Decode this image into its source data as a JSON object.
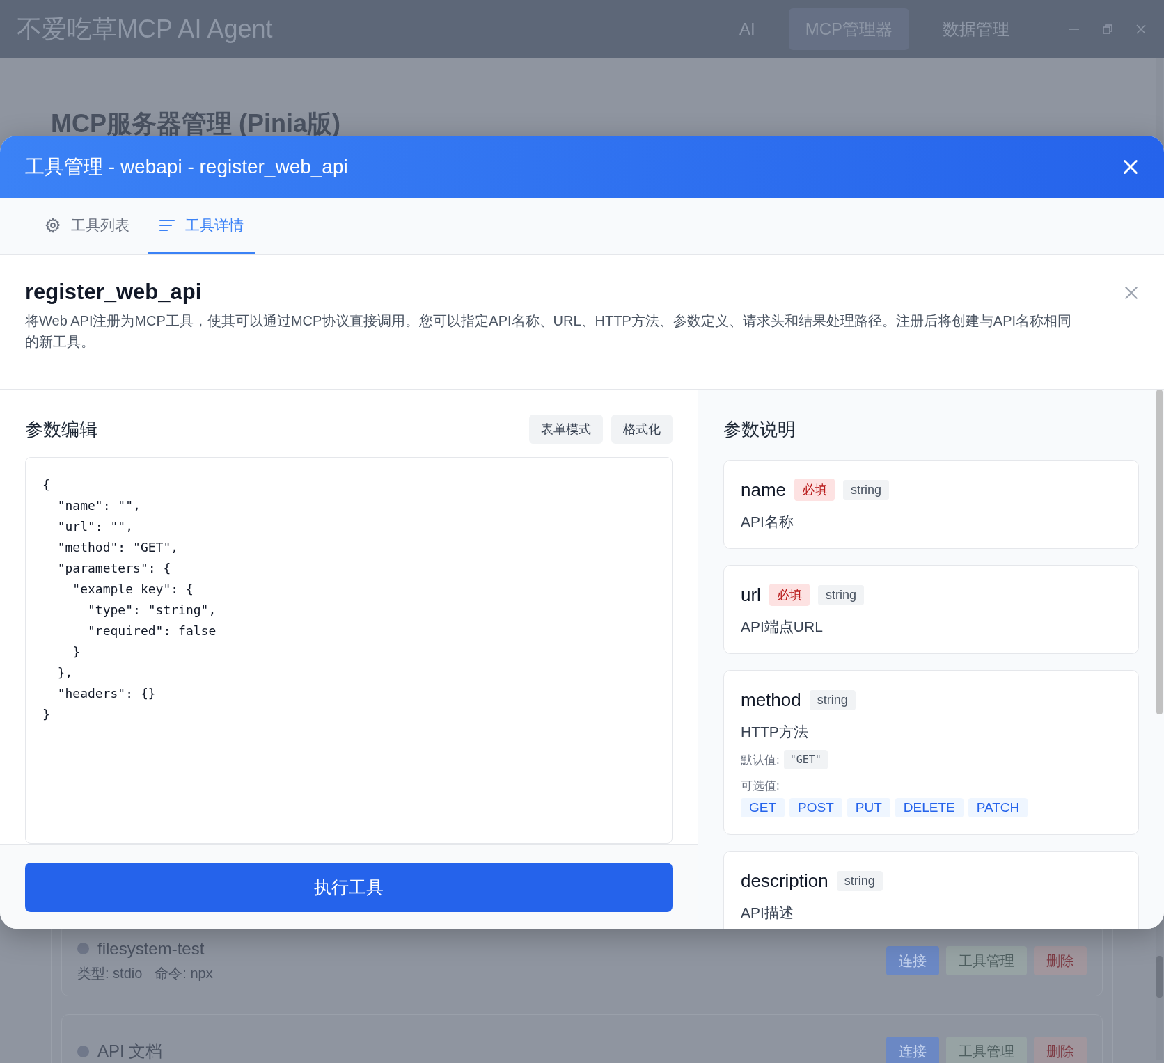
{
  "window": {
    "title": "不爱吃草MCP AI Agent",
    "nav": [
      {
        "label": "AI",
        "selected": false
      },
      {
        "label": "MCP管理器",
        "selected": true
      },
      {
        "label": "数据管理",
        "selected": false
      }
    ]
  },
  "page": {
    "heading": "MCP服务器管理 (Pinia版)",
    "servers": [
      {
        "name": "filesystem-test",
        "meta": [
          "类型: stdio",
          "命令: npx"
        ],
        "actions": [
          {
            "label": "连接",
            "kind": "primary"
          },
          {
            "label": "工具管理",
            "kind": "secondary"
          },
          {
            "label": "删除",
            "kind": "danger"
          }
        ]
      },
      {
        "name": "API 文档",
        "actions": [
          {
            "label": "连接",
            "kind": "primary"
          },
          {
            "label": "工具管理",
            "kind": "secondary"
          },
          {
            "label": "删除",
            "kind": "danger"
          }
        ]
      }
    ]
  },
  "dialog": {
    "title": "工具管理 - webapi - register_web_api",
    "tabs": [
      {
        "label": "工具列表",
        "selected": false
      },
      {
        "label": "工具详情",
        "selected": true
      }
    ],
    "tool": {
      "name": "register_web_api",
      "description": "将Web API注册为MCP工具，使其可以通过MCP协议直接调用。您可以指定API名称、URL、HTTP方法、参数定义、请求头和结果处理路径。注册后将创建与API名称相同的新工具。"
    },
    "editor": {
      "heading": "参数编辑",
      "buttons": [
        "表单模式",
        "格式化"
      ],
      "code": "{\n  \"name\": \"\",\n  \"url\": \"\",\n  \"method\": \"GET\",\n  \"parameters\": {\n    \"example_key\": {\n      \"type\": \"string\",\n      \"required\": false\n    }\n  },\n  \"headers\": {}\n}"
    },
    "execute_button": "执行工具",
    "params": {
      "heading": "参数说明",
      "items": [
        {
          "name": "name",
          "badges": [
            {
              "text": "必填",
              "kind": "required"
            },
            {
              "text": "string",
              "kind": "type"
            }
          ],
          "description": "API名称"
        },
        {
          "name": "url",
          "badges": [
            {
              "text": "必填",
              "kind": "required"
            },
            {
              "text": "string",
              "kind": "type"
            }
          ],
          "description": "API端点URL"
        },
        {
          "name": "method",
          "badges": [
            {
              "text": "string",
              "kind": "type"
            }
          ],
          "description": "HTTP方法",
          "default_label": "默认值:",
          "default": "\"GET\"",
          "options_label": "可选值:",
          "options": [
            "GET",
            "POST",
            "PUT",
            "DELETE",
            "PATCH"
          ]
        },
        {
          "name": "description",
          "badges": [
            {
              "text": "string",
              "kind": "type"
            }
          ],
          "description": "API描述"
        }
      ]
    }
  }
}
